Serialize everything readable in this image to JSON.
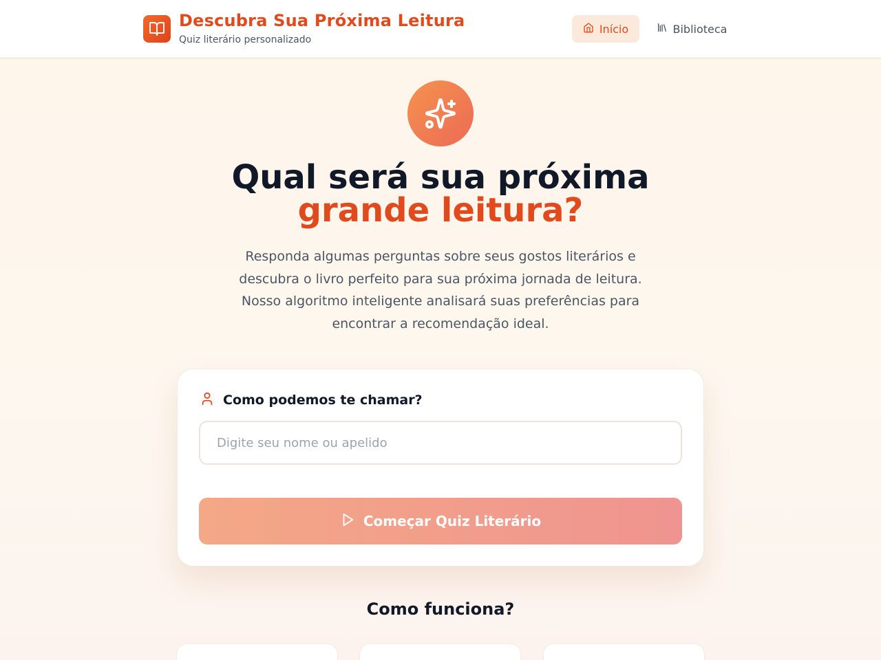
{
  "header": {
    "title": "Descubra Sua Próxima Leitura",
    "subtitle": "Quiz literário personalizado",
    "nav": [
      {
        "label": "Início",
        "icon": "home-icon",
        "active": true
      },
      {
        "label": "Biblioteca",
        "icon": "library-icon",
        "active": false
      }
    ]
  },
  "hero": {
    "icon": "sparkles-icon",
    "headline_line1": "Qual será sua próxima",
    "headline_line2": "grande leitura?",
    "description": "Responda algumas perguntas sobre seus gostos literários e descubra o livro perfeito para sua próxima jornada de leitura. Nosso algoritmo inteligente analisará suas preferências para encontrar a recomendação ideal."
  },
  "form": {
    "label": "Como podemos te chamar?",
    "label_icon": "user-icon",
    "input_value": "",
    "input_placeholder": "Digite seu nome ou apelido",
    "button_label": "Começar Quiz Literário",
    "button_icon": "play-icon"
  },
  "how_it_works": {
    "title": "Como funciona?"
  },
  "colors": {
    "brand": "#e04a1c",
    "accent_gradient_start": "#f5934e",
    "accent_gradient_end": "#ec6a56"
  }
}
